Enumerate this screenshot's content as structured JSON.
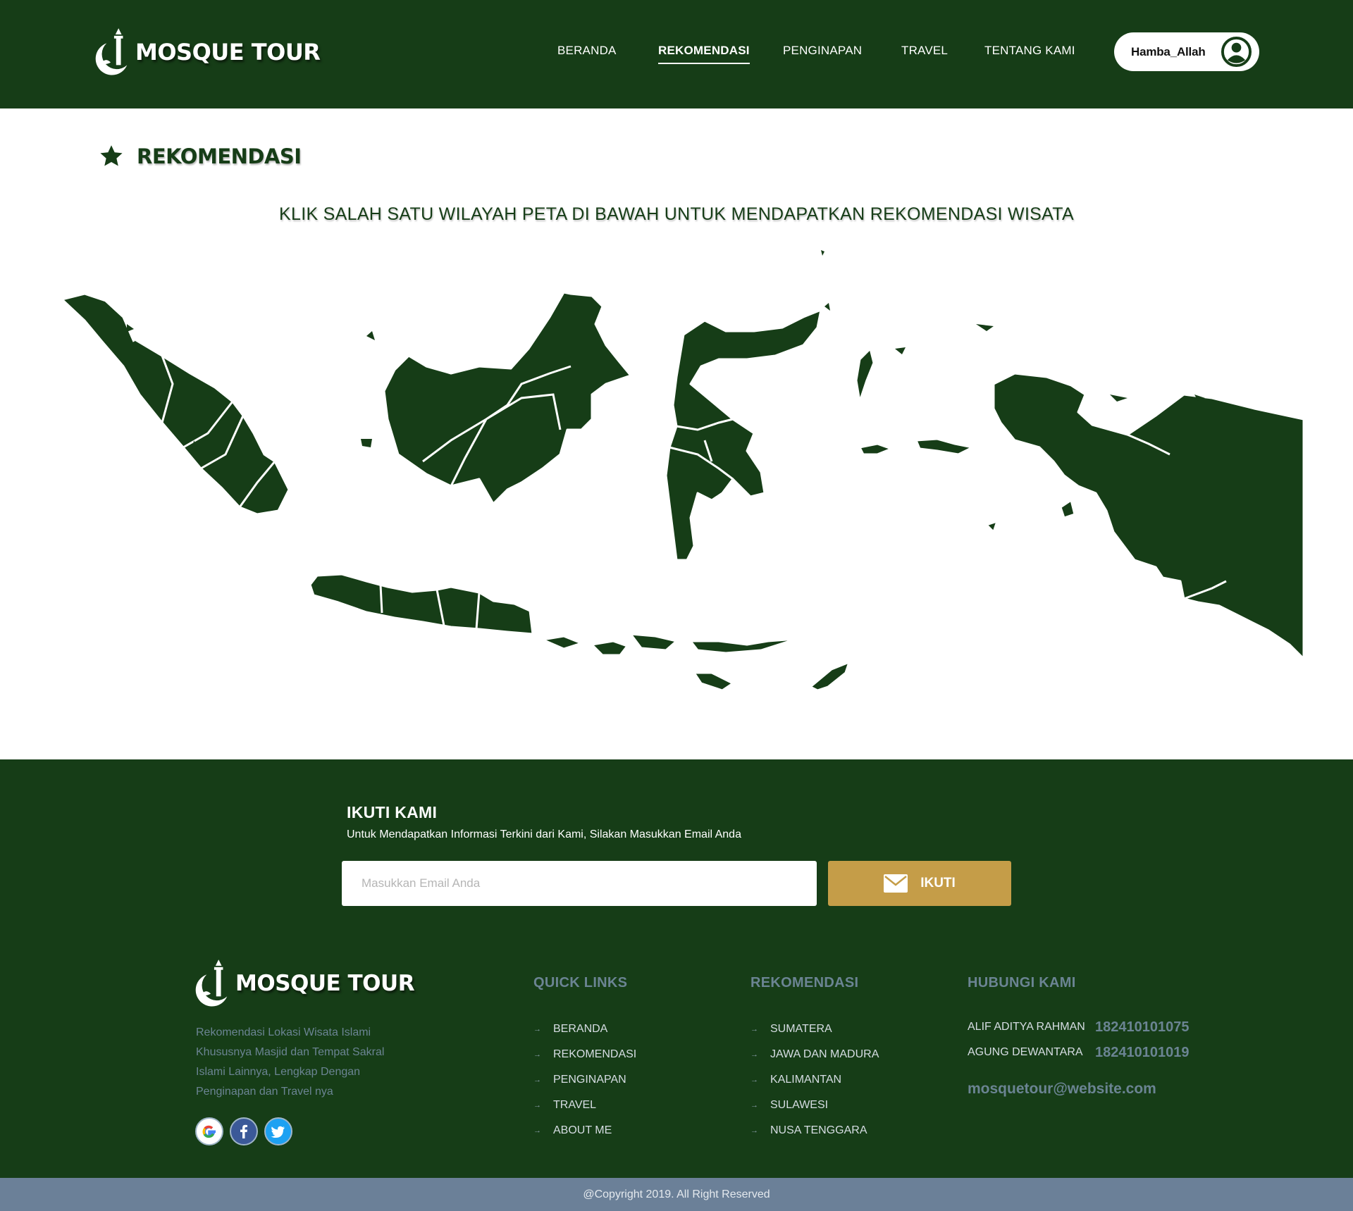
{
  "brand": {
    "name": "MOSQUE TOUR",
    "icon": "mosque-moon-icon"
  },
  "nav": {
    "items": [
      {
        "label": "BERANDA",
        "active": false
      },
      {
        "label": "REKOMENDASI",
        "active": true
      },
      {
        "label": "PENGINAPAN",
        "active": false
      },
      {
        "label": "TRAVEL",
        "active": false
      },
      {
        "label": "TENTANG KAMI",
        "active": false
      }
    ]
  },
  "user": {
    "name": "Hamba_Allah",
    "icon": "user-circle-icon"
  },
  "page": {
    "title": "REKOMENDASI",
    "title_icon": "star-icon",
    "instruction": "KLIK SALAH SATU WILAYAH PETA DI BAWAH UNTUK MENDAPATKAN REKOMENDASI WISATA"
  },
  "map": {
    "regions": [
      "Sumatera",
      "Jawa",
      "Kalimantan",
      "Sulawesi",
      "Nusa Tenggara",
      "Maluku",
      "Papua"
    ]
  },
  "subscribe": {
    "title": "IKUTI KAMI",
    "description": "Untuk Mendapatkan Informasi Terkini dari Kami, Silakan Masukkan Email Anda",
    "placeholder": "Masukkan Email Anda",
    "button_label": "IKUTI",
    "button_icon": "envelope-icon"
  },
  "footer": {
    "about": "Rekomendasi Lokasi Wisata Islami Khususnya Masjid dan Tempat Sakral Islami Lainnya, Lengkap Dengan Penginapan dan Travel nya",
    "socials": [
      "google-icon",
      "facebook-icon",
      "twitter-icon"
    ],
    "quick_links": {
      "title": "QUICK LINKS",
      "items": [
        "BERANDA",
        "REKOMENDASI",
        "PENGINAPAN",
        "TRAVEL",
        "ABOUT ME"
      ]
    },
    "recommendations": {
      "title": "REKOMENDASI",
      "items": [
        "SUMATERA",
        "JAWA DAN MADURA",
        "KALIMANTAN",
        "SULAWESI",
        "NUSA TENGGARA"
      ]
    },
    "contact": {
      "title": "HUBUNGI KAMI",
      "people": [
        {
          "name": "ALIF ADITYA RAHMAN",
          "nim": "182410101075"
        },
        {
          "name": "AGUNG DEWANTARA",
          "nim": "182410101019"
        }
      ],
      "email": "mosquetour@website.com"
    }
  },
  "copyright": "@Copyright 2019. All Right Reserved",
  "colors": {
    "primary": "#163d17",
    "accent": "#c59d48",
    "muted": "#6b8493",
    "bar": "#6b8098"
  }
}
